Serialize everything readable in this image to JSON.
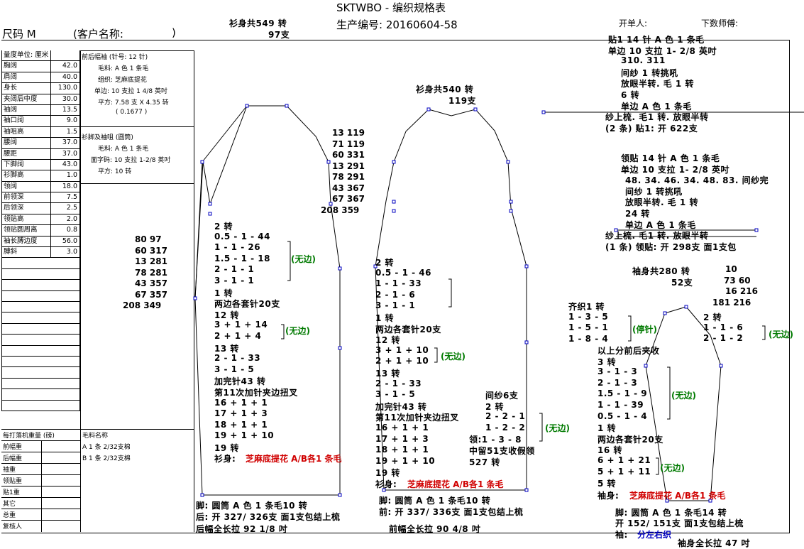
{
  "header": {
    "title": "SKTWBO - 编织规格表",
    "prod_no": "生产编号: 20160604-58",
    "size": "尺码 M",
    "client": "(客户名称:",
    "client_close": ")",
    "opener": "开单人:",
    "master": "下数师傅:",
    "body_total": "衫身共549 转",
    "body_total2": "97支"
  },
  "measurements": [
    {
      "label": "量度单位: 厘米",
      "value": ""
    },
    {
      "label": "胸阔",
      "value": "42.0"
    },
    {
      "label": "肩阔",
      "value": "40.0"
    },
    {
      "label": "身长",
      "value": "130.0"
    },
    {
      "label": "夹阔后中度",
      "value": "30.0"
    },
    {
      "label": "袖阔",
      "value": "13.5"
    },
    {
      "label": "袖口阔",
      "value": "9.0"
    },
    {
      "label": "袖咀高",
      "value": "1.5"
    },
    {
      "label": "腰阔",
      "value": "37.0"
    },
    {
      "label": "腰距",
      "value": "37.0"
    },
    {
      "label": "下脚阔",
      "value": "43.0"
    },
    {
      "label": "衫脚高",
      "value": "1.0"
    },
    {
      "label": "领阔",
      "value": "18.0"
    },
    {
      "label": "前领深",
      "value": "7.5"
    },
    {
      "label": "后领深",
      "value": "2.5"
    },
    {
      "label": "领贴高",
      "value": "2.0"
    },
    {
      "label": "领贴圆周离",
      "value": "0.8"
    },
    {
      "label": "袖长膊边度",
      "value": "56.0"
    },
    {
      "label": "膊斜",
      "value": "3.0"
    }
  ],
  "gauge": {
    "title": "前后幅袖 (针号: 12 针)",
    "lines": [
      "毛料: A 色 1 条毛",
      "组织: 芝麻底提花",
      "单边: 10 支拉 1 4/8 英吋",
      "平方: 7.58 支 X 4.35 转",
      "( 0.1677 )"
    ],
    "title2": "衫脚及袖咀 (圆筒)",
    "lines2": [
      "毛料: A 色 1 条毛",
      "面字码: 10 支拉 1-2/8 英吋",
      "平方: 10 转"
    ]
  },
  "weights": {
    "title": "每打落机重量 (磅)",
    "material_title": "毛料名称",
    "rows": [
      "前幅重",
      "后幅重",
      "袖重",
      "领贴重",
      "贴1重",
      "其它",
      "总重",
      "复核人"
    ],
    "materials": [
      "A  1 条 2/32支棉",
      "B  1 条 2/32支棉"
    ]
  },
  "left_table": [
    "80     97",
    "60    317",
    "13    281",
    "78    281",
    "43    357",
    "67    357",
    "208    349"
  ],
  "back": {
    "table": [
      "13     119",
      "71     119",
      "60     331",
      "13     291",
      "78     291",
      "43     367",
      "67     367",
      "208     359"
    ],
    "steps": [
      "2  转",
      "0.5 - 1 - 44",
      "1 - 1 - 26",
      "1.5 - 1 - 18",
      "2 - 1 - 1",
      "3 - 1 - 1",
      "1  转",
      "两边各套针20支",
      "12  转",
      "3 + 1 + 14",
      "2 + 1 + 4",
      "13  转",
      "2 - 1 - 33",
      "3 - 1 - 5",
      "加完针43  转",
      "第11次加针夹边扭叉",
      "16 + 1 + 1",
      "17 + 1 + 3",
      "18 + 1 + 1",
      "19 + 1 + 10",
      "19  转"
    ],
    "no_edge": "(无边)",
    "fabric_label": "衫身:",
    "fabric": "芝麻底提花  A/B各1  条毛",
    "foot": "脚:  圆筒    A 色  1  条毛10  转",
    "open": "后:  开  327/ 326支  面1支包结上梳",
    "length": "后幅全长拉  92  1/8  吋"
  },
  "front": {
    "total": "衫身共540  转",
    "total2": "119支",
    "steps": [
      "2  转",
      "0.5 - 1 - 46",
      "1 - 1 - 33",
      "2 - 1 - 6",
      "3 - 1 - 1",
      "1  转",
      "两边各套针20支",
      "12  转",
      "3 + 1 + 10",
      "2 + 1 + 10",
      "13  转",
      "2 - 1 - 33",
      "3 - 1 - 5",
      "加完针43  转",
      "第11次加针夹边扭叉",
      "16 + 1 + 1",
      "17 + 1 + 3",
      "18 + 1 + 1",
      "19 + 1 + 10",
      "19  转"
    ],
    "neck": [
      "间纱6支",
      "2  转",
      "2 - 2 - 1",
      "1 - 2 - 2",
      "领:1 - 3 - 8",
      "中留51支收假领",
      "527  转"
    ],
    "fabric_label": "衫身:",
    "fabric": "芝麻底提花  A/B各1  条毛",
    "foot": "脚:  圆筒    A 色  1  条毛10  转",
    "open": "前:  开  337/ 336支  面1支包结上梳",
    "length": "前幅全长拉  90  4/8  吋"
  },
  "trim": {
    "lines": [
      "贴1   14  针  A  色  1  条毛",
      "单边  10  支拉  1- 2/8  英吋",
      "310. 311",
      "间纱 1 转挑吼",
      "放眼半转.  毛 1 转",
      "6  转",
      "单边  A  色  1  条毛",
      "纱上梳.  毛1  转.  放眼半转",
      "(2  条) 贴1:  开  622支"
    ],
    "collar": [
      "领贴   14  针  A  色  1  条毛",
      "单边  10  支拉  1- 2/8  英吋",
      "48. 34. 46. 34. 48. 83.  间纱完",
      "间纱 1 转挑吼",
      "放眼半转.  毛 1 转",
      "24  转",
      "单边  A  色  1  条毛",
      "纱上梳.  毛1  转.  放眼半转",
      "(1  条) 领贴:  开  298支  面1支包"
    ]
  },
  "sleeve": {
    "total": "袖身共280  转",
    "total2": "52支",
    "table": [
      "10",
      "73     60",
      "16    216",
      "181    216"
    ],
    "cap": [
      "齐织1  转",
      "1 - 3 - 5",
      "1 - 5 - 1",
      "1 - 8 - 4"
    ],
    "stop": "(停针)",
    "top": [
      "2  转",
      "1 - 1 - 6",
      "2 - 1 - 2"
    ],
    "steps": [
      "以上分前后夹收",
      "3  转",
      "3 - 1 - 3",
      "2 - 1 - 3",
      "1.5 - 1 - 9",
      "1 - 1 - 39",
      "0.5 - 1 - 4",
      "1  转",
      "两边各套针20支",
      "16  转",
      "6 + 1 + 21",
      "5 + 1 + 11",
      "5  转"
    ],
    "fabric_label": "袖身:",
    "fabric": "芝麻底提花  A/B各1  条毛",
    "foot": "脚:  圆筒    A 色  1  条毛14  转",
    "open": "开  152/ 151支  面1支包结上梳",
    "side_label": "袖:",
    "side": "分左右织",
    "length": "袖身全长拉  47  吋"
  },
  "colors": {
    "red": "#d00000",
    "green": "#007a00",
    "blue": "#0000c0",
    "handle": "#0000c0"
  }
}
